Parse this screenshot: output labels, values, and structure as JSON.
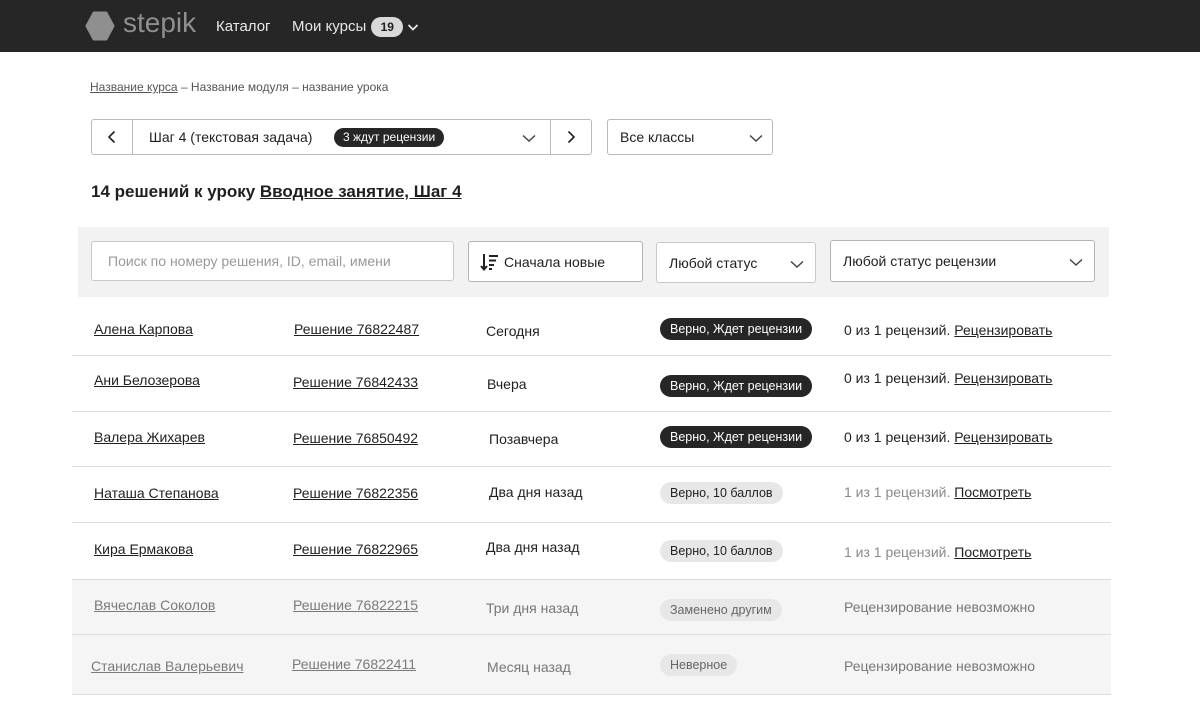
{
  "nav": {
    "logo_text": "stepik",
    "catalog": "Каталог",
    "my_courses": "Мои курсы",
    "my_courses_count": "19"
  },
  "breadcrumb": {
    "course": "Название курса",
    "rest": " – Название модуля – название урока"
  },
  "step": {
    "title": "Шаг 4 (текстовая задача)",
    "badge": "3 ждут рецензии"
  },
  "class_filter": "Все классы",
  "heading": {
    "prefix": "14 решений к уроку ",
    "link": "Вводное занятие, Шаг 4"
  },
  "filters": {
    "search_placeholder": "Поиск по номеру решения, ID, email, имени",
    "sort": "Сначала новые",
    "status": "Любой статус",
    "review_status": "Любой статус рецензии"
  },
  "rows": [
    {
      "name": "Алена Карпова",
      "solution": "Решение 76822487",
      "date": "Сегодня",
      "status": "Верно, Ждет рецензии",
      "review": "0 из 1 рецензий. ",
      "action": "Рецензировать"
    },
    {
      "name": "Ани Белозерова",
      "solution": "Решение 76842433",
      "date": "Вчера",
      "status": "Верно, Ждет рецензии",
      "review": "0 из 1 рецензий. ",
      "action": "Рецензировать"
    },
    {
      "name": "Валера Жихарев",
      "solution": "Решение 76850492",
      "date": "Позавчера",
      "status": "Верно, Ждет рецензии",
      "review": "0 из 1 рецензий. ",
      "action": "Рецензировать"
    },
    {
      "name": "Наташа Степанова",
      "solution": "Решение 76822356",
      "date": "Два дня назад",
      "status": "Верно, 10 баллов",
      "review": "1 из 1 рецензий. ",
      "action": "Посмотреть"
    },
    {
      "name": "Кира Ермакова",
      "solution": "Решение 76822965",
      "date": "Два дня назад",
      "status": "Верно, 10 баллов",
      "review": "1 из 1 рецензий. ",
      "action": "Посмотреть"
    },
    {
      "name": "Вячеслав Соколов",
      "solution": "Решение 76822215",
      "date": "Три дня назад",
      "status": "Заменено другим",
      "review": "Рецензирование невозможно",
      "action": ""
    },
    {
      "name": "Станислав Валерьевич",
      "solution": "Решение 76822411",
      "date": "Месяц назад",
      "status": "Неверное",
      "review": "Рецензирование невозможно",
      "action": ""
    }
  ]
}
